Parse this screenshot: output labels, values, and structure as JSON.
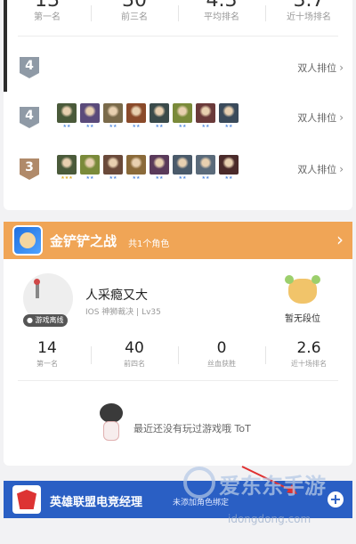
{
  "top_stats": [
    {
      "value": "13",
      "label": "第一名"
    },
    {
      "value": "30",
      "label": "前三名"
    },
    {
      "value": "4.3",
      "label": "平均排名"
    },
    {
      "value": "3.7",
      "label": "近十场排名"
    }
  ],
  "rank_rows": [
    {
      "rank": "4",
      "badge_color": "#8f9aa6",
      "link": "双人排位",
      "champs": []
    },
    {
      "rank": "4",
      "badge_color": "#8f9aa6",
      "link": "双人排位",
      "champs": [
        {
          "color": "#4a5a3a",
          "stars": "★★",
          "star_color": "#5a8fe0"
        },
        {
          "color": "#5a4a7a",
          "stars": "★★",
          "star_color": "#5a8fe0"
        },
        {
          "color": "#7a6a4a",
          "stars": "★★",
          "star_color": "#5a8fe0"
        },
        {
          "color": "#8a4a2a",
          "stars": "★★",
          "star_color": "#5a8fe0"
        },
        {
          "color": "#3a4a4a",
          "stars": "★★",
          "star_color": "#5a8fe0"
        },
        {
          "color": "#7a8a3a",
          "stars": "★★",
          "star_color": "#5a8fe0"
        },
        {
          "color": "#6a3a3a",
          "stars": "★★",
          "star_color": "#5a8fe0"
        },
        {
          "color": "#3a4a5a",
          "stars": "★★",
          "star_color": "#5a8fe0"
        }
      ]
    },
    {
      "rank": "3",
      "badge_color": "#b08a6a",
      "link": "双人排位",
      "champs": [
        {
          "color": "#4a5a3a",
          "stars": "★★★",
          "star_color": "#e0b030"
        },
        {
          "color": "#7a8a3a",
          "stars": "★★",
          "star_color": "#5a8fe0"
        },
        {
          "color": "#6a4a3a",
          "stars": "★★",
          "star_color": "#5a8fe0"
        },
        {
          "color": "#8a6a3a",
          "stars": "★★",
          "star_color": "#5a8fe0"
        },
        {
          "color": "#5a3a5a",
          "stars": "★★",
          "star_color": "#5a8fe0"
        },
        {
          "color": "#4a5a6a",
          "stars": "★★",
          "star_color": "#5a8fe0"
        },
        {
          "color": "#5a6a7a",
          "stars": "★★",
          "star_color": "#5a8fe0"
        },
        {
          "color": "#4a2a2a",
          "stars": "★★",
          "star_color": "#5a8fe0"
        }
      ]
    }
  ],
  "game_header": {
    "title": "金铲铲之战",
    "subtitle": "共1个角色",
    "chevron": "›"
  },
  "profile": {
    "name": "人采瘾又大",
    "info": "IOS 神狮裁决 | Lv35",
    "status": "● 游戏离线",
    "rank_label": "暂无段位"
  },
  "game_stats": [
    {
      "value": "14",
      "label": "第一名"
    },
    {
      "value": "40",
      "label": "前四名"
    },
    {
      "value": "0",
      "label": "丝血获胜"
    },
    {
      "value": "2.6",
      "label": "近十场排名"
    }
  ],
  "empty_message": "最近还没有玩过游戏哦 ToT",
  "bottom_bar": {
    "title": "英雄联盟电竞经理",
    "subtitle": "未添加角色绑定",
    "plus": "+"
  },
  "watermark": {
    "name": "爱东东手游",
    "url": "idongdong.com"
  },
  "colors": {
    "gold": "#f0a556",
    "blue": "#2a5fc4"
  }
}
